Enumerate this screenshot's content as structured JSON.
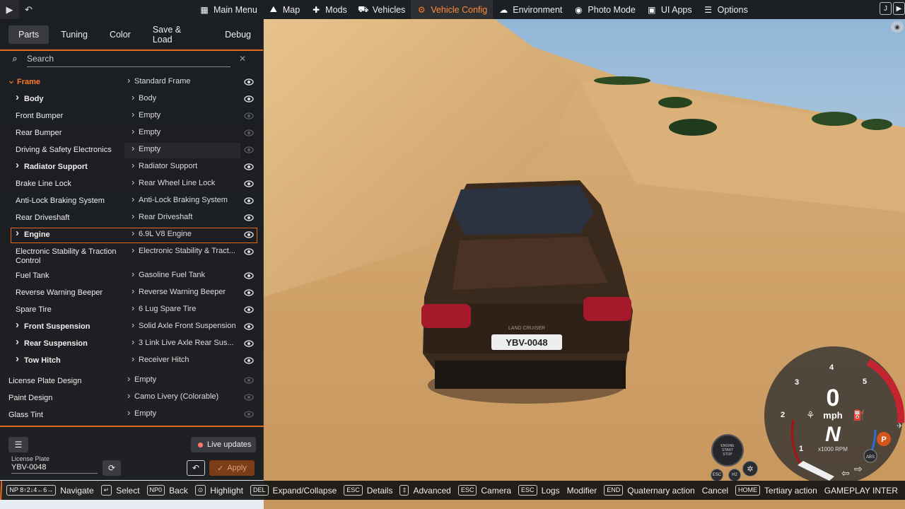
{
  "topbar": {
    "menu": [
      {
        "label": "Main Menu",
        "icon": "main-menu-icon",
        "glyph": "▦",
        "active": false
      },
      {
        "label": "Map",
        "icon": "map-icon",
        "glyph": "⛰",
        "active": false
      },
      {
        "label": "Mods",
        "icon": "puzzle-icon",
        "glyph": "✚",
        "active": false
      },
      {
        "label": "Vehicles",
        "icon": "car-icon",
        "glyph": "⛟",
        "active": false
      },
      {
        "label": "Vehicle Config",
        "icon": "engine-icon",
        "glyph": "⚙",
        "active": true
      },
      {
        "label": "Environment",
        "icon": "weather-icon",
        "glyph": "☁",
        "active": false
      },
      {
        "label": "Photo Mode",
        "icon": "camera-icon",
        "glyph": "◉",
        "active": false
      },
      {
        "label": "UI Apps",
        "icon": "apps-icon",
        "glyph": "▣",
        "active": false
      },
      {
        "label": "Options",
        "icon": "options-icon",
        "glyph": "☰",
        "active": false
      }
    ],
    "right_key": "J"
  },
  "panel": {
    "tabs": [
      "Parts",
      "Tuning",
      "Color",
      "Save & Load",
      "Debug"
    ],
    "active_tab": "Parts",
    "search_placeholder": "Search",
    "rows": [
      {
        "label": "Frame",
        "value": "Standard Frame",
        "expanded": true,
        "highlight": true,
        "indent": 0,
        "visible": true
      },
      {
        "label": "Body",
        "value": "Body",
        "expandable": true,
        "indent": 1,
        "visible": true
      },
      {
        "label": "Front Bumper",
        "value": "Empty",
        "indent": 1,
        "visible": false
      },
      {
        "label": "Rear Bumper",
        "value": "Empty",
        "indent": 1,
        "visible": false
      },
      {
        "label": "Driving & Safety Electronics",
        "value": "Empty",
        "indent": 1,
        "visible": false,
        "hover": true
      },
      {
        "label": "Radiator Support",
        "value": "Radiator Support",
        "expandable": true,
        "indent": 1,
        "visible": true
      },
      {
        "label": "Brake Line Lock",
        "value": "Rear Wheel Line Lock",
        "indent": 1,
        "visible": true
      },
      {
        "label": "Anti-Lock Braking System",
        "value": "Anti-Lock Braking System",
        "indent": 1,
        "visible": true
      },
      {
        "label": "Rear Driveshaft",
        "value": "Rear Driveshaft",
        "indent": 1,
        "visible": true
      },
      {
        "label": "Engine",
        "value": "6.9L V8 Engine",
        "expandable": true,
        "indent": 1,
        "visible": true,
        "selected": true
      },
      {
        "label": "Electronic Stability & Traction",
        "label2": "Control",
        "value": "Electronic Stability & Tract...",
        "indent": 1,
        "visible": true,
        "tall": true
      },
      {
        "label": "Fuel Tank",
        "value": "Gasoline Fuel Tank",
        "indent": 1,
        "visible": true
      },
      {
        "label": "Reverse Warning Beeper",
        "value": "Reverse Warning Beeper",
        "indent": 1,
        "visible": true
      },
      {
        "label": "Spare Tire",
        "value": "6 Lug Spare Tire",
        "indent": 1,
        "visible": true
      },
      {
        "label": "Front Suspension",
        "value": "Solid Axle Front Suspension",
        "expandable": true,
        "indent": 1,
        "visible": true
      },
      {
        "label": "Rear Suspension",
        "value": "3 Link Live Axle Rear Sus...",
        "expandable": true,
        "indent": 1,
        "visible": true
      },
      {
        "label": "Tow Hitch",
        "value": "Receiver Hitch",
        "expandable": true,
        "indent": 1,
        "visible": true
      },
      {
        "label": "License Plate Design",
        "value": "Empty",
        "indent": 0,
        "visible": false
      },
      {
        "label": "Paint Design",
        "value": "Camo Livery (Colorable)",
        "indent": 0,
        "visible": false
      },
      {
        "label": "Glass Tint",
        "value": "Empty",
        "indent": 0,
        "visible": false
      }
    ],
    "live_updates": "Live updates",
    "license_plate_label": "License Plate",
    "license_plate_value": "YBV-0048",
    "apply": "Apply"
  },
  "hints": [
    {
      "key": "NP 8↑2↓4←6→",
      "label": "Navigate"
    },
    {
      "key": "↵",
      "label": "Select"
    },
    {
      "key": "NP0",
      "label": "Back"
    },
    {
      "key": "⊙",
      "label": "Highlight"
    },
    {
      "key": "DEL",
      "label": "Expand/Collapse"
    },
    {
      "key": "ESC",
      "label": "Details"
    },
    {
      "key": "‡",
      "label": "Advanced"
    },
    {
      "key": "ESC",
      "label": "Camera"
    },
    {
      "key": "ESC",
      "label": "Logs"
    },
    {
      "key": "",
      "label": "Modifier"
    },
    {
      "key": "END",
      "label": "Quaternary action"
    },
    {
      "key": "",
      "label": "Cancel"
    },
    {
      "key": "HOME",
      "label": "Tertiary action"
    },
    {
      "key": "",
      "label": "GAMEPLAY INTER"
    }
  ],
  "hud": {
    "speed": "0",
    "unit": "mph",
    "gear": "N",
    "rpm_unit": "x1000 RPM",
    "ticks": [
      "1",
      "2",
      "3",
      "4",
      "5"
    ],
    "engine_btn": [
      "ENGINE",
      "START",
      "STOP"
    ],
    "esc": "ESC",
    "parking": "P",
    "abs": "ABS",
    "h2": "H2"
  },
  "scene": {
    "plate": "YBV-0048",
    "badge": "LAND CRUISER"
  },
  "colors": {
    "accent": "#e36a1c",
    "sand": "#d8a86d",
    "sky": "#bcd3e6"
  }
}
